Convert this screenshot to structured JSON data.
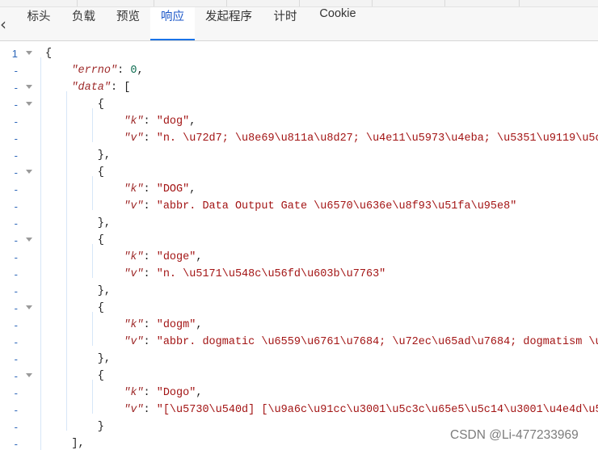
{
  "tabs": [
    {
      "label": "标头"
    },
    {
      "label": "负载"
    },
    {
      "label": "预览"
    },
    {
      "label": "响应"
    },
    {
      "label": "发起程序"
    },
    {
      "label": "计时"
    },
    {
      "label": "Cookie"
    }
  ],
  "active_tab": "响应",
  "response": {
    "lines": [
      {
        "num": "1",
        "fold": true,
        "text": "{"
      },
      {
        "num": "-",
        "fold": false,
        "text": "    \"errno\": 0,"
      },
      {
        "num": "-",
        "fold": true,
        "text": "    \"data\": ["
      },
      {
        "num": "-",
        "fold": true,
        "text": "        {"
      },
      {
        "num": "-",
        "fold": false,
        "text": "            \"k\": \"dog\","
      },
      {
        "num": "-",
        "fold": false,
        "text": "            \"v\": \"n. \\u72d7; \\u8e69\\u811a\\u8d27; \\u4e11\\u5973\\u4eba; \\u5351\\u9119\\u5c0f\\u4eba\""
      },
      {
        "num": "-",
        "fold": false,
        "text": "        },"
      },
      {
        "num": "-",
        "fold": true,
        "text": "        {"
      },
      {
        "num": "-",
        "fold": false,
        "text": "            \"k\": \"DOG\","
      },
      {
        "num": "-",
        "fold": false,
        "text": "            \"v\": \"abbr. Data Output Gate \\u6570\\u636e\\u8f93\\u51fa\\u95e8\""
      },
      {
        "num": "-",
        "fold": false,
        "text": "        },"
      },
      {
        "num": "-",
        "fold": true,
        "text": "        {"
      },
      {
        "num": "-",
        "fold": false,
        "text": "            \"k\": \"doge\","
      },
      {
        "num": "-",
        "fold": false,
        "text": "            \"v\": \"n. \\u5171\\u548c\\u56fd\\u603b\\u7763\""
      },
      {
        "num": "-",
        "fold": false,
        "text": "        },"
      },
      {
        "num": "-",
        "fold": true,
        "text": "        {"
      },
      {
        "num": "-",
        "fold": false,
        "text": "            \"k\": \"dogm\","
      },
      {
        "num": "-",
        "fold": false,
        "text": "            \"v\": \"abbr. dogmatic \\u6559\\u6761\\u7684; \\u72ec\\u65ad\\u7684; dogmatism \\u6559"
      },
      {
        "num": "-",
        "fold": false,
        "text": "        },"
      },
      {
        "num": "-",
        "fold": true,
        "text": "        {"
      },
      {
        "num": "-",
        "fold": false,
        "text": "            \"k\": \"Dogo\","
      },
      {
        "num": "-",
        "fold": false,
        "text": "            \"v\": \"[\\u5730\\u540d] [\\u9a6c\\u91cc\\u3001\\u5c3c\\u65e5\\u5c14\\u3001\\u4e4d\\u5f97"
      },
      {
        "num": "-",
        "fold": false,
        "text": "        }"
      },
      {
        "num": "-",
        "fold": false,
        "text": "    ],"
      }
    ]
  },
  "watermark": "CSDN @Li-477233969"
}
